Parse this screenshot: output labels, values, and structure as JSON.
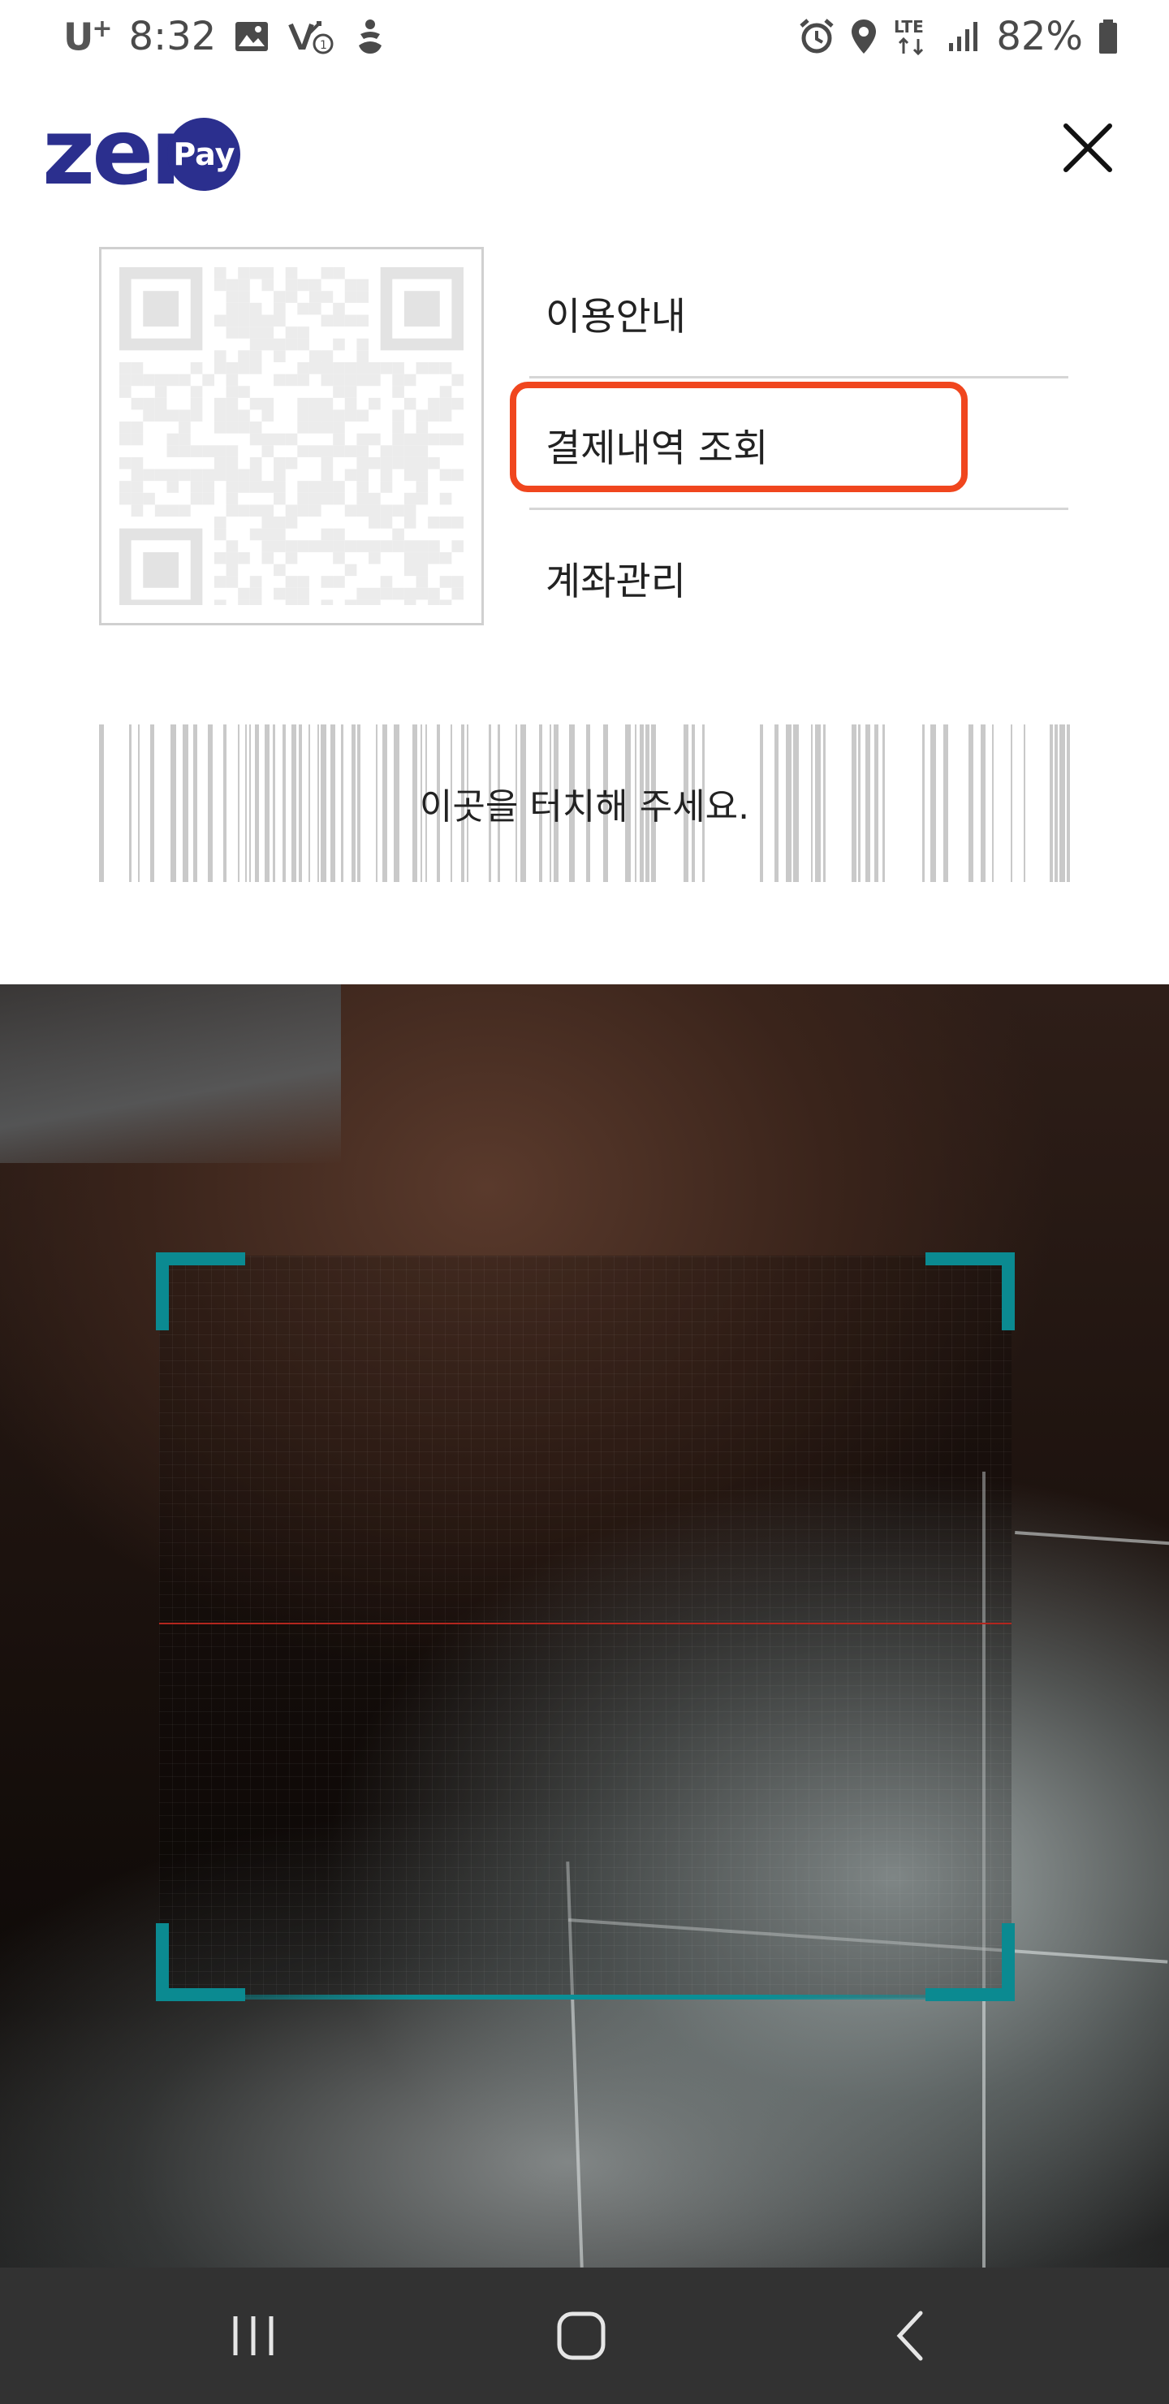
{
  "status_bar": {
    "carrier": "U",
    "carrier_sup": "+",
    "time": "8:32",
    "network": "LTE",
    "battery": "82%",
    "left_icons": [
      "gallery-icon",
      "missed-call-icon",
      "accessibility-icon"
    ],
    "right_icons": [
      "alarm-icon",
      "location-icon",
      "lte-icon",
      "signal-icon",
      "battery-icon"
    ]
  },
  "header": {
    "logo_main": "zer",
    "logo_badge": "Pay",
    "close_icon": "close-icon"
  },
  "menu": {
    "items": [
      {
        "label": "이용안내"
      },
      {
        "label": "결제내역 조회"
      },
      {
        "label": "계좌관리"
      }
    ],
    "highlighted_index": 1,
    "highlight_color": "#f0461e"
  },
  "barcode": {
    "instruction": "이곳을 터치해 주세요."
  },
  "scanner": {
    "frame_color": "#0b8a91",
    "scan_line_color": "#b3261e"
  },
  "nav_bar": {
    "buttons": [
      "recent-apps-icon",
      "home-icon",
      "back-icon"
    ]
  },
  "colors": {
    "brand": "#2b2f8e",
    "navbar": "#323232"
  }
}
